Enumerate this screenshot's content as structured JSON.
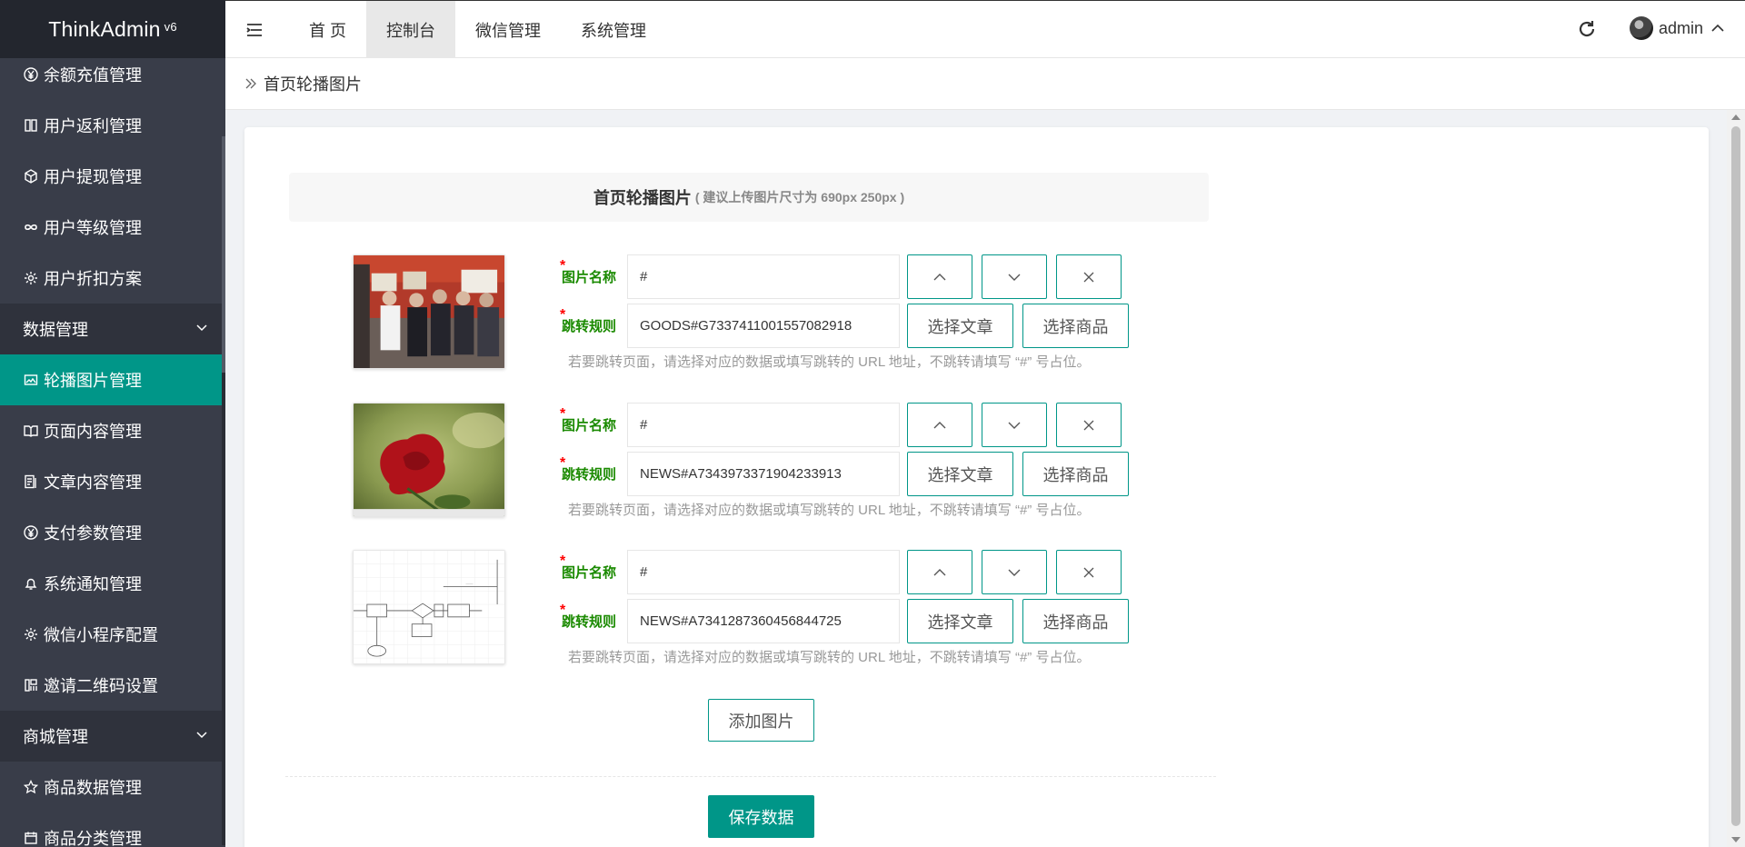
{
  "app": {
    "name": "ThinkAdmin",
    "version": "v6"
  },
  "header": {
    "nav": [
      "首 页",
      "控制台",
      "微信管理",
      "系统管理"
    ],
    "active_nav": "控制台",
    "user": "admin"
  },
  "breadcrumb": "首页轮播图片",
  "sidebar": {
    "items": [
      {
        "label": "余额充值管理",
        "icon": "yen-icon"
      },
      {
        "label": "用户返利管理",
        "icon": "book-icon"
      },
      {
        "label": "用户提现管理",
        "icon": "cube-icon"
      },
      {
        "label": "用户等级管理",
        "icon": "infinity-icon"
      },
      {
        "label": "用户折扣方案",
        "icon": "gear-icon"
      }
    ],
    "group1": "数据管理",
    "group1_items": [
      {
        "label": "轮播图片管理",
        "icon": "image-icon",
        "active": true
      },
      {
        "label": "页面内容管理",
        "icon": "open-book-icon"
      },
      {
        "label": "文章内容管理",
        "icon": "document-icon"
      },
      {
        "label": "支付参数管理",
        "icon": "yen-icon"
      },
      {
        "label": "系统通知管理",
        "icon": "bell-icon"
      },
      {
        "label": "微信小程序配置",
        "icon": "gear-icon"
      },
      {
        "label": "邀请二维码设置",
        "icon": "qrcode-icon"
      }
    ],
    "group2": "商城管理",
    "group2_items": [
      {
        "label": "商品数据管理",
        "icon": "star-icon"
      },
      {
        "label": "商品分类管理",
        "icon": "calendar-icon"
      }
    ]
  },
  "form": {
    "title": "首页轮播图片",
    "title_hint": "( 建议上传图片尺寸为 690px 250px )",
    "label_name": "图片名称",
    "label_rule": "跳转规则",
    "help": "若要跳转页面，请选择对应的数据或填写跳转的 URL 地址，不跳转请填写 “#” 号占位。",
    "btn_article": "选择文章",
    "btn_goods": "选择商品",
    "rows": [
      {
        "name": "#",
        "rule": "GOODS#G7337411001557082918",
        "image": "group-photo"
      },
      {
        "name": "#",
        "rule": "NEWS#A7343973371904233913",
        "image": "red-rose"
      },
      {
        "name": "#",
        "rule": "NEWS#A7341287360456844725",
        "image": "flowchart-diagram"
      }
    ],
    "add_button": "添加图片",
    "save_button": "保存数据"
  },
  "colors": {
    "accent": "#009688",
    "sidebar_bg": "#393d49",
    "label_green": "#1a8a00"
  }
}
